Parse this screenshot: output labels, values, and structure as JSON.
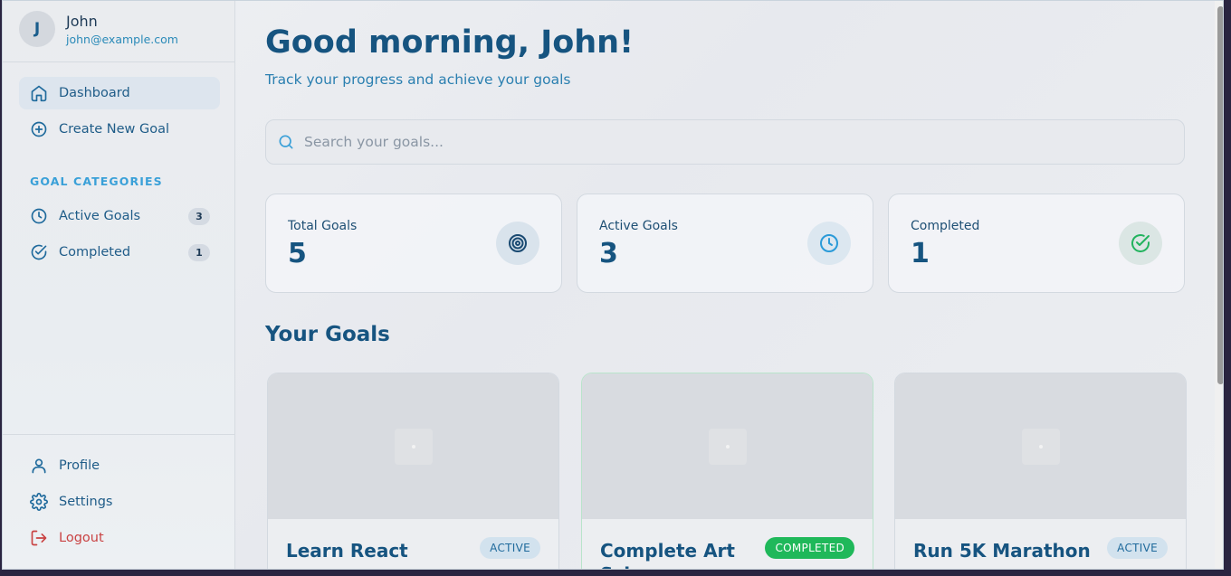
{
  "user": {
    "initial": "J",
    "name": "John",
    "email": "john@example.com"
  },
  "nav": {
    "dashboard": "Dashboard",
    "create_goal": "Create New Goal",
    "categories_label": "GOAL CATEGORIES",
    "active_goals": "Active Goals",
    "active_count": "3",
    "completed": "Completed",
    "completed_count": "1",
    "profile": "Profile",
    "settings": "Settings",
    "logout": "Logout"
  },
  "header": {
    "greeting": "Good morning, John!",
    "subtitle": "Track your progress and achieve your goals"
  },
  "search": {
    "placeholder": "Search your goals...",
    "value": ""
  },
  "stats": [
    {
      "label": "Total Goals",
      "value": "5",
      "icon": "target-icon"
    },
    {
      "label": "Active Goals",
      "value": "3",
      "icon": "clock-icon"
    },
    {
      "label": "Completed",
      "value": "1",
      "icon": "check-circle-icon"
    }
  ],
  "goals_section": {
    "title": "Your Goals"
  },
  "goals": [
    {
      "title": "Learn React",
      "status": "ACTIVE"
    },
    {
      "title": "Complete Art Sch...",
      "status": "COMPLETED"
    },
    {
      "title": "Run 5K Marathon",
      "status": "ACTIVE"
    }
  ],
  "colors": {
    "primary": "#165480",
    "accent": "#2a8ab8",
    "success": "#1fb85a",
    "danger": "#c94343"
  }
}
